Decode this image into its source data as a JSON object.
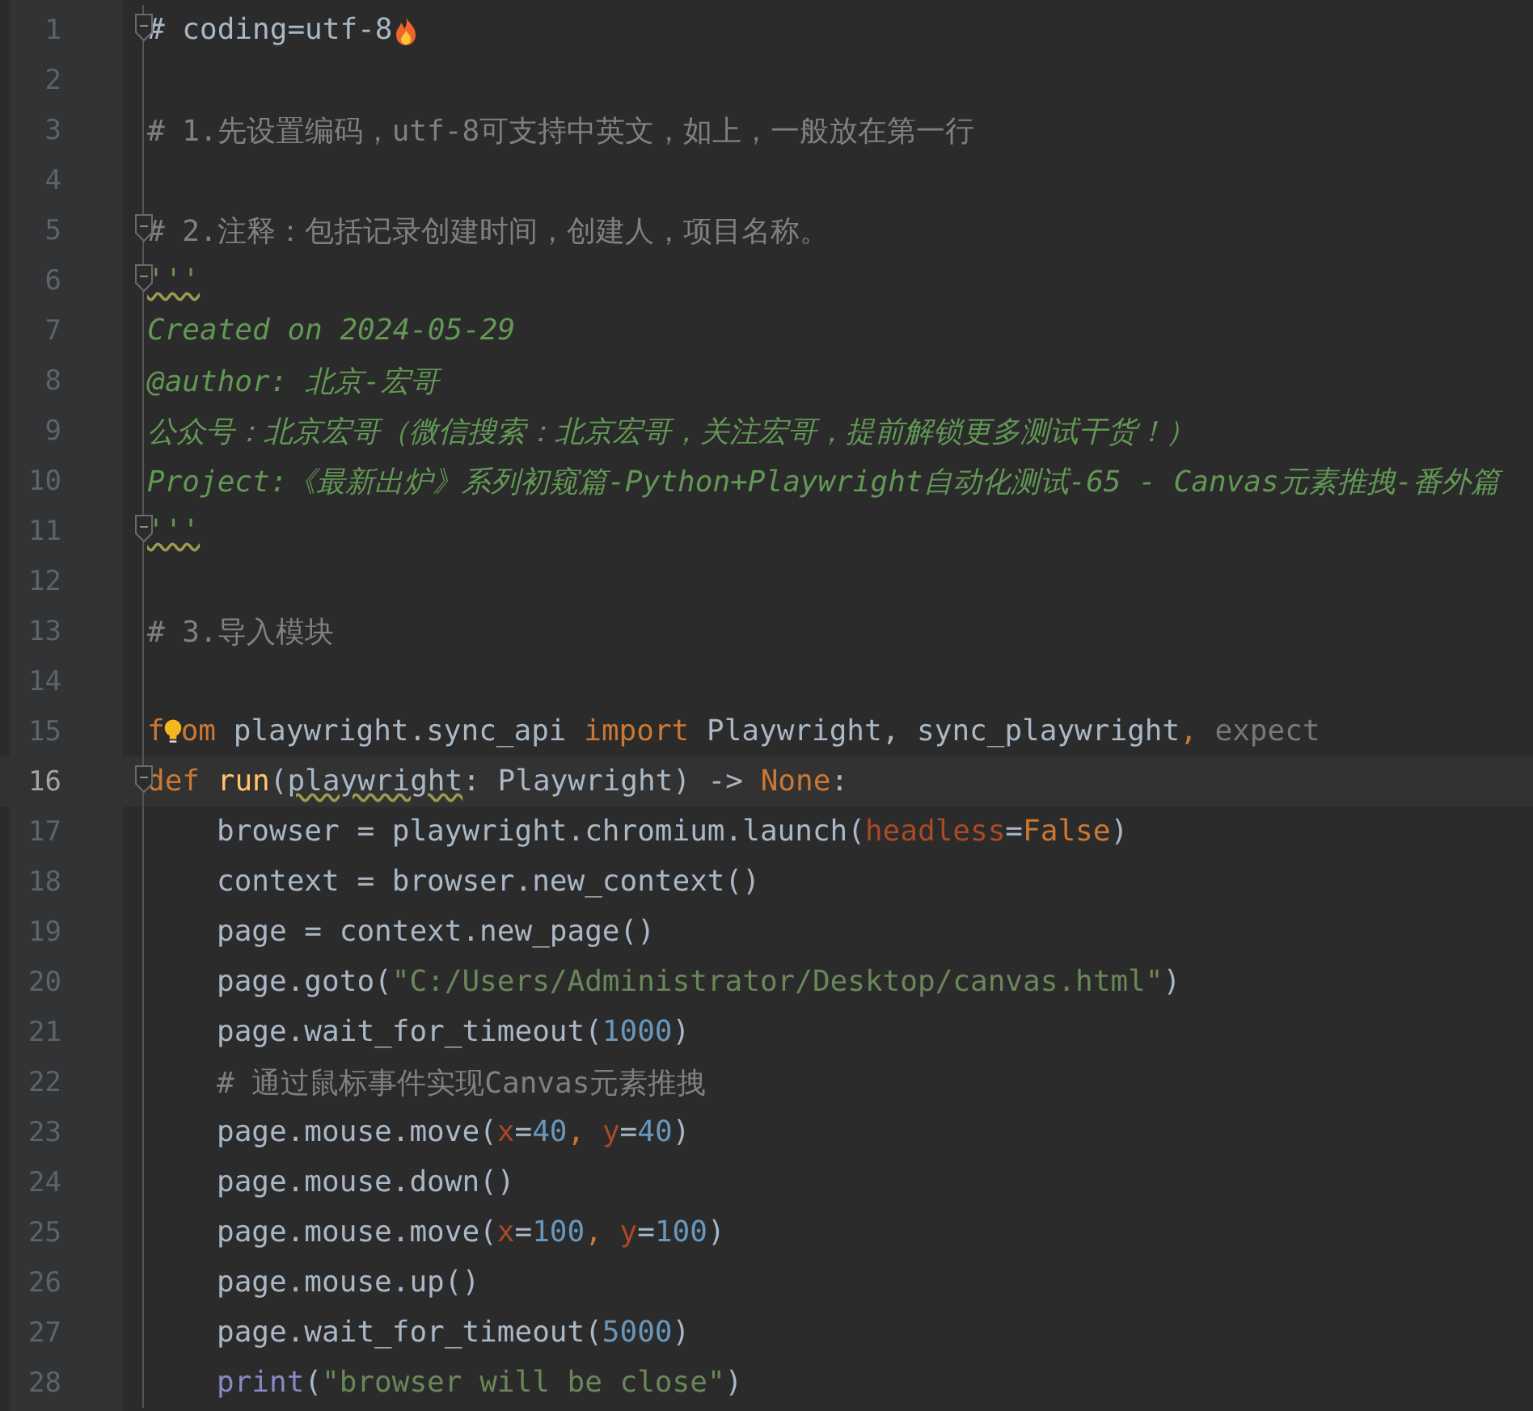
{
  "editor": {
    "lines": [
      {
        "number": "1",
        "fold": true,
        "selected": false,
        "indented": false,
        "tokens": [
          {
            "kind": "text",
            "text": "# coding=utf-8"
          },
          {
            "kind": "fire"
          }
        ]
      },
      {
        "number": "2",
        "fold": false,
        "selected": false,
        "indented": false
      },
      {
        "number": "3",
        "fold": false,
        "selected": false,
        "indented": false,
        "tokens": [
          {
            "kind": "comment",
            "text": "# 1.先设置编码，utf-8可支持中英文，如上，一般放在第一行"
          }
        ]
      },
      {
        "number": "4",
        "fold": false,
        "selected": false,
        "indented": false
      },
      {
        "number": "5",
        "fold": true,
        "selected": false,
        "indented": false,
        "tokens": [
          {
            "kind": "comment",
            "text": "# 2.注释：包括记录创建时间，创建人，项目名称。"
          }
        ]
      },
      {
        "number": "6",
        "fold": true,
        "selected": false,
        "indented": false,
        "tokens": [
          {
            "kind": "docwavy",
            "text": "'''"
          }
        ]
      },
      {
        "number": "7",
        "fold": false,
        "selected": false,
        "indented": false,
        "tokens": [
          {
            "kind": "doc",
            "text": "Created on 2024-05-29"
          }
        ]
      },
      {
        "number": "8",
        "fold": false,
        "selected": false,
        "indented": false,
        "tokens": [
          {
            "kind": "doc",
            "text": "@author: 北京-宏哥"
          }
        ]
      },
      {
        "number": "9",
        "fold": false,
        "selected": false,
        "indented": false,
        "tokens": [
          {
            "kind": "doc",
            "text": "公众号：北京宏哥（微信搜索：北京宏哥，关注宏哥，提前解锁更多测试干货！）"
          }
        ]
      },
      {
        "number": "10",
        "fold": false,
        "selected": false,
        "indented": false,
        "tokens": [
          {
            "kind": "doc",
            "text": "Project:《最新出炉》系列初窥篇-Python+Playwright自动化测试-65 - Canvas元素推拽-番外篇"
          }
        ]
      },
      {
        "number": "11",
        "fold": true,
        "selected": false,
        "indented": false,
        "tokens": [
          {
            "kind": "docwavy",
            "text": "'''"
          }
        ]
      },
      {
        "number": "12",
        "fold": false,
        "selected": false,
        "indented": false
      },
      {
        "number": "13",
        "fold": false,
        "selected": false,
        "indented": false,
        "tokens": [
          {
            "kind": "comment",
            "text": "# 3.导入模块"
          }
        ]
      },
      {
        "number": "14",
        "fold": false,
        "selected": false,
        "indented": false
      },
      {
        "number": "15",
        "fold": false,
        "selected": false,
        "indented": false,
        "tokens": [
          {
            "kind": "keyword",
            "text": "f"
          },
          {
            "kind": "bulb"
          },
          {
            "kind": "keyword",
            "text": "om"
          },
          {
            "kind": "text",
            "text": " playwright.sync_api "
          },
          {
            "kind": "keyword",
            "text": "import"
          },
          {
            "kind": "text",
            "text": " Playwright, sync_playwright"
          },
          {
            "kind": "keyword",
            "text": ","
          },
          {
            "kind": "unused",
            "text": " expect"
          }
        ]
      },
      {
        "number": "16",
        "fold": true,
        "selected": true,
        "indented": false,
        "tokens": [
          {
            "kind": "keyword",
            "text": "def"
          },
          {
            "kind": "function",
            "text": " run"
          },
          {
            "kind": "text",
            "text": "("
          },
          {
            "kind": "wavy",
            "text": "playwright"
          },
          {
            "kind": "text",
            "text": ": Playwright) -> "
          },
          {
            "kind": "keyword",
            "text": "None"
          },
          {
            "kind": "text",
            "text": ":"
          }
        ]
      },
      {
        "number": "17",
        "fold": false,
        "selected": false,
        "indented": true,
        "tokens": [
          {
            "kind": "text",
            "text": "browser = playwright.chromium.launch("
          },
          {
            "kind": "param",
            "text": "headless"
          },
          {
            "kind": "text",
            "text": "="
          },
          {
            "kind": "keyword",
            "text": "False"
          },
          {
            "kind": "text",
            "text": ")"
          }
        ]
      },
      {
        "number": "18",
        "fold": false,
        "selected": false,
        "indented": true,
        "tokens": [
          {
            "kind": "text",
            "text": "context = browser.new_context()"
          }
        ]
      },
      {
        "number": "19",
        "fold": false,
        "selected": false,
        "indented": true,
        "tokens": [
          {
            "kind": "text",
            "text": "page = context.new_page()"
          }
        ]
      },
      {
        "number": "20",
        "fold": false,
        "selected": false,
        "indented": true,
        "tokens": [
          {
            "kind": "text",
            "text": "page.goto("
          },
          {
            "kind": "string",
            "text": "\"C:/Users/Administrator/Desktop/canvas.html\""
          },
          {
            "kind": "text",
            "text": ")"
          }
        ]
      },
      {
        "number": "21",
        "fold": false,
        "selected": false,
        "indented": true,
        "tokens": [
          {
            "kind": "text",
            "text": "page.wait_for_timeout("
          },
          {
            "kind": "number",
            "text": "1000"
          },
          {
            "kind": "text",
            "text": ")"
          }
        ]
      },
      {
        "number": "22",
        "fold": false,
        "selected": false,
        "indented": true,
        "tokens": [
          {
            "kind": "comment",
            "text": "# 通过鼠标事件实现Canvas元素推拽"
          }
        ]
      },
      {
        "number": "23",
        "fold": false,
        "selected": false,
        "indented": true,
        "tokens": [
          {
            "kind": "text",
            "text": "page.mouse.move("
          },
          {
            "kind": "param",
            "text": "x"
          },
          {
            "kind": "text",
            "text": "="
          },
          {
            "kind": "number",
            "text": "40"
          },
          {
            "kind": "keyword",
            "text": ", "
          },
          {
            "kind": "param",
            "text": "y"
          },
          {
            "kind": "text",
            "text": "="
          },
          {
            "kind": "number",
            "text": "40"
          },
          {
            "kind": "text",
            "text": ")"
          }
        ]
      },
      {
        "number": "24",
        "fold": false,
        "selected": false,
        "indented": true,
        "tokens": [
          {
            "kind": "text",
            "text": "page.mouse.down()"
          }
        ]
      },
      {
        "number": "25",
        "fold": false,
        "selected": false,
        "indented": true,
        "tokens": [
          {
            "kind": "text",
            "text": "page.mouse.move("
          },
          {
            "kind": "param",
            "text": "x"
          },
          {
            "kind": "text",
            "text": "="
          },
          {
            "kind": "number",
            "text": "100"
          },
          {
            "kind": "keyword",
            "text": ", "
          },
          {
            "kind": "param",
            "text": "y"
          },
          {
            "kind": "text",
            "text": "="
          },
          {
            "kind": "number",
            "text": "100"
          },
          {
            "kind": "text",
            "text": ")"
          }
        ]
      },
      {
        "number": "26",
        "fold": false,
        "selected": false,
        "indented": true,
        "tokens": [
          {
            "kind": "text",
            "text": "page.mouse.up()"
          }
        ]
      },
      {
        "number": "27",
        "fold": false,
        "selected": false,
        "indented": true,
        "tokens": [
          {
            "kind": "text",
            "text": "page.wait_for_timeout("
          },
          {
            "kind": "number",
            "text": "5000"
          },
          {
            "kind": "text",
            "text": ")"
          }
        ]
      },
      {
        "number": "28",
        "fold": false,
        "selected": false,
        "indented": true,
        "tokens": [
          {
            "kind": "builtin",
            "text": "print"
          },
          {
            "kind": "text",
            "text": "("
          },
          {
            "kind": "string",
            "text": "\"browser will be close\""
          },
          {
            "kind": "text",
            "text": ")"
          }
        ]
      }
    ]
  }
}
